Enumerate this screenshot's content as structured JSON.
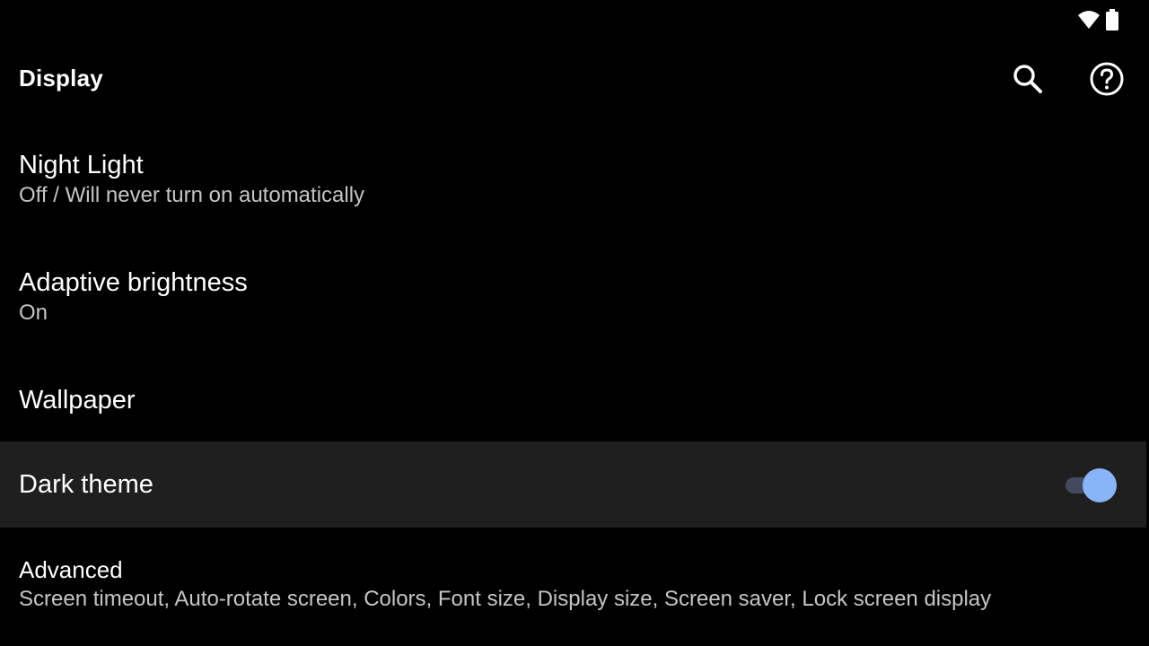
{
  "status_bar": {
    "wifi_icon": "wifi-icon",
    "battery_icon": "battery-icon"
  },
  "app_bar": {
    "title": "Display",
    "search_icon": "search-icon",
    "help_icon": "help-icon"
  },
  "settings": {
    "night_light": {
      "title": "Night Light",
      "summary": "Off / Will never turn on automatically"
    },
    "adaptive_brightness": {
      "title": "Adaptive brightness",
      "summary": "On"
    },
    "wallpaper": {
      "title": "Wallpaper"
    },
    "dark_theme": {
      "title": "Dark theme",
      "enabled": true
    },
    "advanced": {
      "title": "Advanced",
      "summary": "Screen timeout, Auto-rotate screen, Colors, Font size, Display size, Screen saver, Lock screen display"
    }
  },
  "colors": {
    "background": "#000000",
    "highlight_row": "#1f1f1f",
    "toggle_thumb_on": "#8ab4f8",
    "toggle_track_on": "#434a5e",
    "summary_text": "#c5c5c5"
  }
}
